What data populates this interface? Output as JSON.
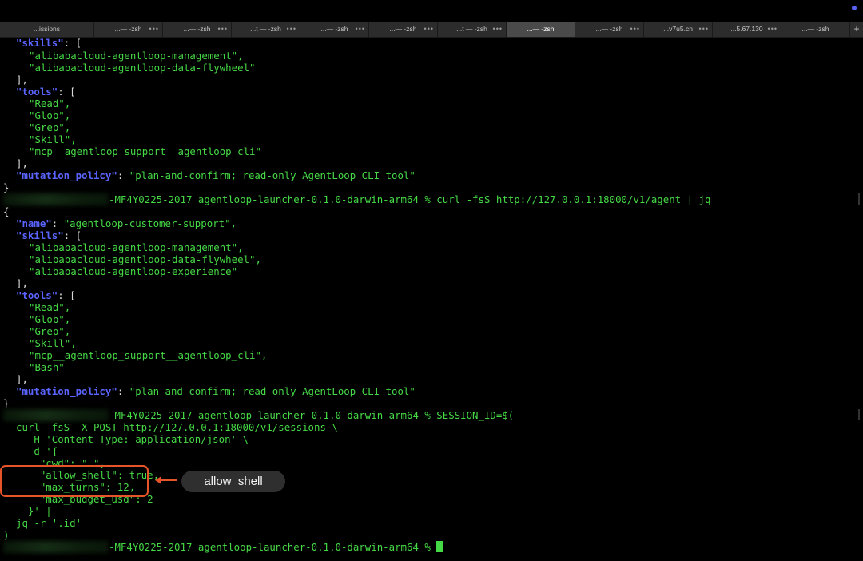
{
  "window": {
    "tabs": [
      {
        "label": "...issions",
        "active": false
      },
      {
        "label": "...— -zsh",
        "active": false
      },
      {
        "label": "...— -zsh",
        "active": false
      },
      {
        "label": "...t — -zsh",
        "active": false
      },
      {
        "label": "...— -zsh",
        "active": false
      },
      {
        "label": "...— -zsh",
        "active": false
      },
      {
        "label": "...t — -zsh",
        "active": false
      },
      {
        "label": "...— -zsh",
        "active": true
      },
      {
        "label": "...— -zsh",
        "active": false
      },
      {
        "label": "...v7u5.cn",
        "active": false
      },
      {
        "label": "...5.67.130",
        "active": false
      },
      {
        "label": "...— -zsh",
        "active": false
      }
    ],
    "tab_more_label": "•••",
    "new_tab_label": "+"
  },
  "terminal": {
    "output1": {
      "skills_key": "\"skills\"",
      "skills": [
        "\"alibabacloud-agentloop-management\",",
        "\"alibabacloud-agentloop-data-flywheel\""
      ],
      "tools_key": "\"tools\"",
      "tools": [
        "\"Read\",",
        "\"Glob\",",
        "\"Grep\",",
        "\"Skill\",",
        "\"mcp__agentloop_support__agentloop_cli\""
      ],
      "mutation_key": "\"mutation_policy\"",
      "mutation_value": "\"plan-and-confirm; read-only AgentLoop CLI tool\""
    },
    "prompt1": "-MF4Y0225-2017 agentloop-launcher-0.1.0-darwin-arm64 % curl -fsS http://127.0.0.1:18000/v1/agent | jq",
    "output2": {
      "name_key": "\"name\"",
      "name_value": "\"agentloop-customer-support\",",
      "skills_key": "\"skills\"",
      "skills": [
        "\"alibabacloud-agentloop-management\",",
        "\"alibabacloud-agentloop-data-flywheel\",",
        "\"alibabacloud-agentloop-experience\""
      ],
      "tools_key": "\"tools\"",
      "tools": [
        "\"Read\",",
        "\"Glob\",",
        "\"Grep\",",
        "\"Skill\",",
        "\"mcp__agentloop_support__agentloop_cli\",",
        "\"Bash\""
      ],
      "mutation_key": "\"mutation_policy\"",
      "mutation_value": "\"plan-and-confirm; read-only AgentLoop CLI tool\""
    },
    "prompt2": "-MF4Y0225-2017 agentloop-launcher-0.1.0-darwin-arm64 % SESSION_ID=$(",
    "command_lines": [
      "curl -fsS -X POST http://127.0.0.1:18000/v1/sessions \\",
      "  -H 'Content-Type: application/json' \\",
      "  -d '{",
      "    \"cwd\": \".\",",
      "    \"allow_shell\": true,",
      "    \"max_turns\": 12,",
      "    \"max_budget_usd\": 2",
      "  }' |",
      "jq -r '.id'",
      ")"
    ],
    "prompt3": "-MF4Y0225-2017 agentloop-launcher-0.1.0-darwin-arm64 % "
  },
  "annotation": {
    "callout_label": "allow_shell",
    "highlight_color": "#e8542a"
  },
  "colors": {
    "text_green": "#46d946",
    "json_key_blue": "#5a64ff",
    "background": "#000000"
  }
}
